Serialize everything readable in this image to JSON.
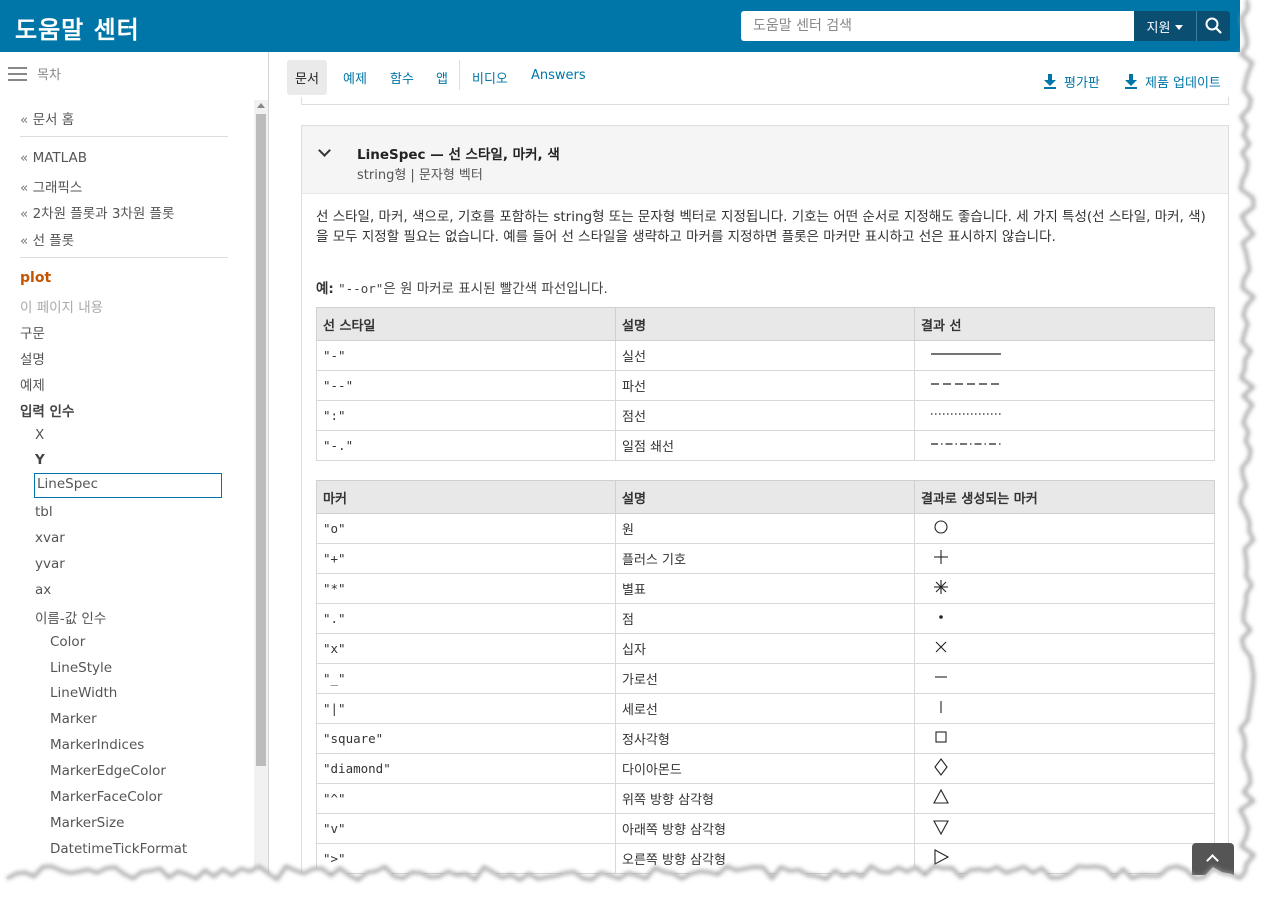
{
  "header": {
    "brand": "도움말 센터",
    "search_placeholder": "도움말 센터 검색",
    "scope_label": "지원"
  },
  "sidebar": {
    "toc_label": "목차",
    "home_crumb": "문서 홈",
    "crumbs": [
      "MATLAB",
      "그래픽스",
      "2차원 플롯과 3차원 플롯",
      "선 플롯"
    ],
    "active_page": "plot",
    "on_this_page": "이 페이지 내용",
    "sections": [
      "구문",
      "설명",
      "예제"
    ],
    "input_args": "입력 인수",
    "args": [
      "X",
      "Y",
      "LineSpec",
      "tbl",
      "xvar",
      "yvar",
      "ax"
    ],
    "name_value_args": "이름-값 인수",
    "name_value_items": [
      "Color",
      "LineStyle",
      "LineWidth",
      "Marker",
      "MarkerIndices",
      "MarkerEdgeColor",
      "MarkerFaceColor",
      "MarkerSize",
      "DatetimeTickFormat"
    ]
  },
  "tabs": {
    "items": [
      "문서",
      "예제",
      "함수",
      "앱",
      "비디오",
      "Answers"
    ],
    "active": "문서",
    "trial": "평가판",
    "updates": "제품 업데이트"
  },
  "argument": {
    "title": "LineSpec — 선 스타일, 마커, 색",
    "subtitle": "string형 | 문자형 벡터",
    "description": "선 스타일, 마커, 색으로, 기호를 포함하는 string형 또는 문자형 벡터로 지정됩니다. 기호는 어떤 순서로 지정해도 좋습니다. 세 가지 특성(선 스타일, 마커, 색)을 모두 지정할 필요는 없습니다. 예를 들어 선 스타일을 생략하고 마커를 지정하면 플롯은 마커만 표시하고 선은 표시하지 않습니다.",
    "example_label": "예:",
    "example_code": "\"--or\"",
    "example_text": "은 원 마커로 표시된 빨간색 파선입니다."
  },
  "line_table": {
    "headers": [
      "선 스타일",
      "설명",
      "결과 선"
    ],
    "rows": [
      {
        "symbol": "\"-\"",
        "desc": "실선",
        "style": "solid"
      },
      {
        "symbol": "\"--\"",
        "desc": "파선",
        "style": "dashed"
      },
      {
        "symbol": "\":\"",
        "desc": "점선",
        "style": "dotted"
      },
      {
        "symbol": "\"-.\"",
        "desc": "일점 쇄선",
        "style": "dashdot"
      }
    ]
  },
  "marker_table": {
    "headers": [
      "마커",
      "설명",
      "결과로 생성되는 마커"
    ],
    "rows": [
      {
        "symbol": "\"o\"",
        "desc": "원",
        "marker": "circle"
      },
      {
        "symbol": "\"+\"",
        "desc": "플러스 기호",
        "marker": "plus"
      },
      {
        "symbol": "\"*\"",
        "desc": "별표",
        "marker": "asterisk"
      },
      {
        "symbol": "\".\"",
        "desc": "점",
        "marker": "point"
      },
      {
        "symbol": "\"x\"",
        "desc": "십자",
        "marker": "cross"
      },
      {
        "symbol": "\"_\"",
        "desc": "가로선",
        "marker": "hline"
      },
      {
        "symbol": "\"|\"",
        "desc": "세로선",
        "marker": "vline"
      },
      {
        "symbol": "\"square\"",
        "desc": "정사각형",
        "marker": "square"
      },
      {
        "symbol": "\"diamond\"",
        "desc": "다이아몬드",
        "marker": "diamond"
      },
      {
        "symbol": "\"^\"",
        "desc": "위쪽 방향 삼각형",
        "marker": "triangle-up"
      },
      {
        "symbol": "\"v\"",
        "desc": "아래쪽 방향 삼각형",
        "marker": "triangle-down"
      },
      {
        "symbol": "\">\"",
        "desc": "오른쪽 방향 삼각형",
        "marker": "triangle-right"
      }
    ]
  }
}
